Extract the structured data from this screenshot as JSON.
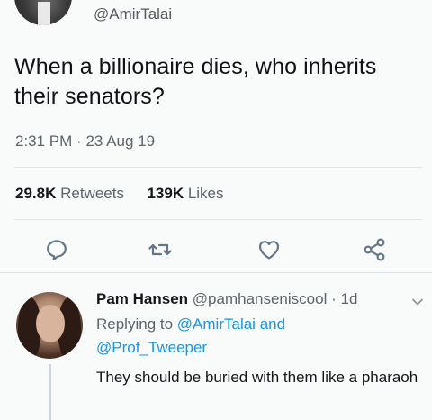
{
  "tweet": {
    "handle": "@AmirTalai",
    "text": "When a billionaire dies, who inherits their senators?",
    "time": "2:31 PM",
    "separator": "·",
    "date": "23 Aug 19",
    "retweets_count": "29.8K",
    "retweets_label": "Retweets",
    "likes_count": "139K",
    "likes_label": "Likes"
  },
  "actions": {
    "icons": [
      "reply-icon",
      "retweet-icon",
      "like-icon",
      "share-icon"
    ]
  },
  "reply": {
    "name": "Pam Hansen",
    "handle": "@pamhanseniscool",
    "separator": "·",
    "age": "1d",
    "replying_prefix": "Replying to",
    "mention_1": "@AmirTalai",
    "and_word": "and",
    "mention_2": "@Prof_Tweeper",
    "text": "They should be buried with them like a pharaoh"
  },
  "colors": {
    "link": "#1b95e0",
    "muted": "#5d646b",
    "text": "#14171a",
    "icon": "#657786"
  }
}
